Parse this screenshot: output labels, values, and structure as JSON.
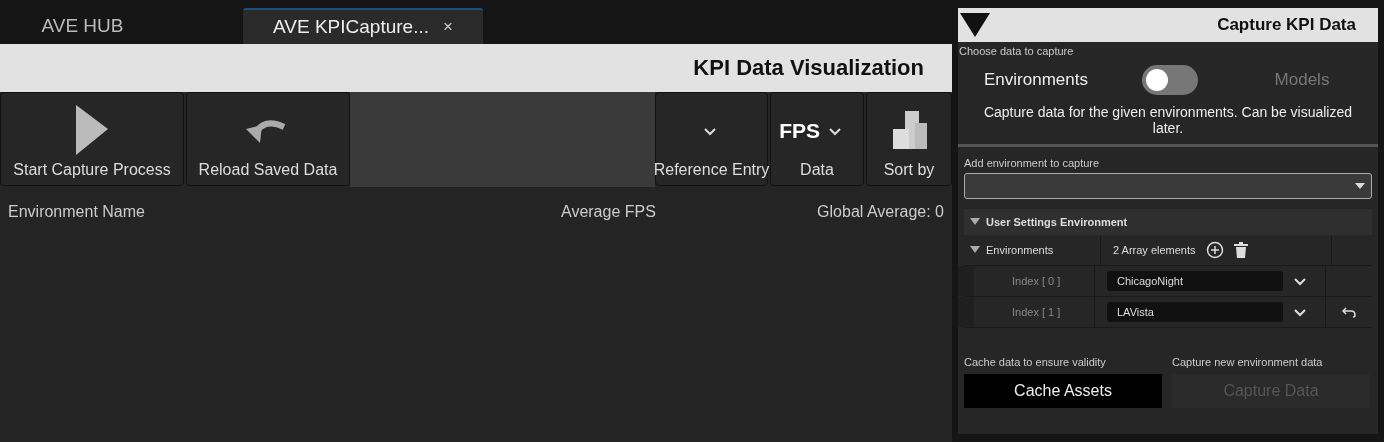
{
  "tabs": [
    {
      "label": "AVE HUB",
      "selected": false
    },
    {
      "label": "AVE KPICapture...",
      "selected": true,
      "close": "×"
    }
  ],
  "title": "KPI Data Visualization",
  "toolbar_left": [
    {
      "kind": "play",
      "label": "Start Capture Process"
    },
    {
      "kind": "reload",
      "label": "Reload Saved Data"
    }
  ],
  "toolbar_right": [
    {
      "kind": "dropdown",
      "label": "Reference Entry"
    },
    {
      "kind": "dropdown",
      "value": "FPS",
      "label": "Data"
    },
    {
      "kind": "sort",
      "label": "Sort by"
    }
  ],
  "table": {
    "columns": [
      "Environment Name",
      "Average FPS"
    ],
    "global_average": "Global Average: 0"
  },
  "capture_panel": {
    "title": "Capture KPI Data",
    "section_label": "Choose data to capture",
    "toggle": {
      "left": "Environments",
      "right": "Models",
      "on": false
    },
    "description": "Capture data for the given environments. Can be visualized later.",
    "add_label": "Add environment to capture",
    "category": {
      "label": "User Settings Environment",
      "expanded": true
    },
    "array": {
      "label": "Environments",
      "expanded": true,
      "count": "2 Array elements",
      "items": [
        {
          "index": "Index [ 0 ]",
          "value": "ChicagoNight",
          "reset": false
        },
        {
          "index": "Index [ 1 ]",
          "value": "LAVista",
          "reset": true
        }
      ]
    },
    "actions": [
      {
        "caption": "Cache data to ensure validity",
        "label": "Cache Assets",
        "disabled": false
      },
      {
        "caption": "Capture new environment data",
        "label": "Capture Data",
        "disabled": true
      }
    ]
  }
}
